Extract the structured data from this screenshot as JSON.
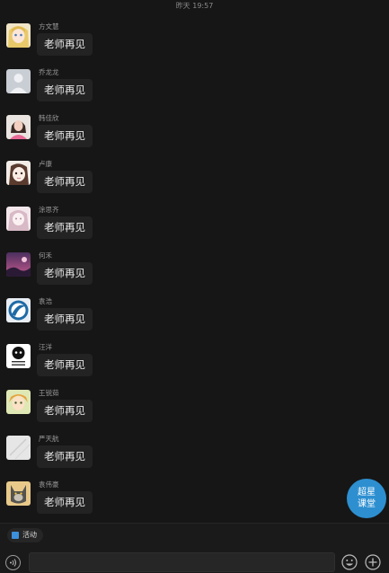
{
  "header": {
    "timestamp": "昨天 19:57"
  },
  "messages": [
    {
      "sender": "方文慧",
      "text": "老师再见",
      "avatar": "anime-blonde-girl"
    },
    {
      "sender": "乔龙龙",
      "text": "老师再见",
      "avatar": "default-gray-person"
    },
    {
      "sender": "韩佳欣",
      "text": "老师再见",
      "avatar": "girl-pink-photo"
    },
    {
      "sender": "卢康",
      "text": "老师再见",
      "avatar": "anime-girl-sketch"
    },
    {
      "sender": "涂思齐",
      "text": "老师再见",
      "avatar": "pastel-anime"
    },
    {
      "sender": "何禾",
      "text": "老师再见",
      "avatar": "purple-scenery"
    },
    {
      "sender": "袁浩",
      "text": "老师再见",
      "avatar": "blue-logo"
    },
    {
      "sender": "汪洋",
      "text": "老师再见",
      "avatar": "black-white-meme"
    },
    {
      "sender": "王锐茹",
      "text": "老师再见",
      "avatar": "anime-boy-yellow"
    },
    {
      "sender": "严天航",
      "text": "老师再见",
      "avatar": "light-gray-pattern"
    },
    {
      "sender": "袁伟豪",
      "text": "老师再见",
      "avatar": "wolf-cartoon"
    }
  ],
  "fab": {
    "line1": "超星",
    "line2": "课堂"
  },
  "toolbar": {
    "activity_label": "活动"
  },
  "input": {
    "value": "",
    "placeholder": ""
  },
  "colors": {
    "background": "#161616",
    "bubble": "#232323",
    "accent": "#2d8fd0"
  }
}
